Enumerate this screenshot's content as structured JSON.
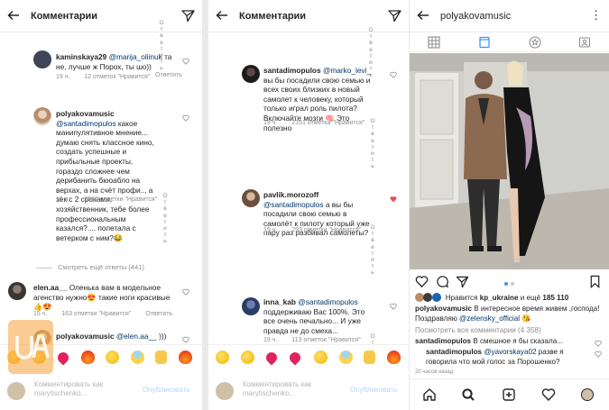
{
  "colors": {
    "mention": "#00376b",
    "meta_gray": "#8e8e8e",
    "heart_red": "#ed4956",
    "publish_disabled": "#b4d5fb",
    "watermark_orange": "#f5a23a"
  },
  "left_panel": {
    "title": "Комментарии",
    "comments": [
      {
        "username": "kaminskaya29",
        "mention": "@marija_oliinuk",
        "text": "та не, лучше ж Порох, ты шо))",
        "time": "19 ч.",
        "likes": "12 отметок \"Нравится\"",
        "reply": "Ответить"
      },
      {
        "username": "polyakovamusic",
        "mention": "@santadimopulos",
        "text": "какое манипулятивное мнение... думаю снять классное кино, создать успешные и прибыльные проекты, гораздо сложнее чем дерибанить бюоабло на верхах, а на счёт профи.., а зек с 2 сроками, хозяйственник, тебе более профессиональным казался?.... полетала с ветерком с ним?😂",
        "time": "19 ч.",
        "likes": "1582 отметки \"Нравится\"",
        "reply": "Ответить"
      },
      {
        "username": "elen.aa__",
        "mention": "",
        "text": "Оленька вам в модельное агенство нужно😍 такие ноги красивые 👍😍",
        "time": "15 ч.",
        "likes": "163 отметки \"Нравится\"",
        "reply": "Ответить"
      },
      {
        "username": "polyakovamusic",
        "mention": "@elen.aa__",
        "text": "))) наконец то хоть кто то заметил",
        "time": "",
        "likes": "",
        "reply": ""
      }
    ],
    "view_more": "Смотреть ещё ответы (441)",
    "input_placeholder": "Комментировать как marytischenko...",
    "publish": "Опубликовать"
  },
  "middle_panel": {
    "title": "Комментарии",
    "comments": [
      {
        "username": "santadimopulos",
        "mention": "@marko_levi_",
        "text": "вы бы посадили свою семью и всех своих близких в новый самолет к человеку, который только играл роль пилота? Включайте мозги 🧠 Это полезно",
        "time": "19 ч.",
        "likes": "2161 отметка \"Нравится\"",
        "reply": "Ответить"
      },
      {
        "username": "pavlik.morozoff",
        "mention": "@santadimopulos",
        "text": "а вы бы посадили свою семью в самолёт к пилоту который уже пару раз разбивал самолеты?",
        "time": "19 ч.",
        "likes": "293 отметки \"Нравится\"",
        "reply": "Ответить"
      },
      {
        "username": "inna_kab",
        "mention": "@santadimopulos",
        "text": "поддерживаю Вас 100%. Это все очень печально... И уже правда не до смеха...",
        "time": "19 ч.",
        "likes": "113 отметок \"Нравится\"",
        "reply": "Ответить"
      }
    ],
    "input_placeholder": "Комментировать как marytischenko...",
    "publish": "Опубликовать"
  },
  "profile_panel": {
    "title": "polyakovamusic",
    "liked_prefix": "Нравится",
    "liked_user": "kp_ukraine",
    "liked_middle": "и ещё",
    "liked_count": "185 110",
    "caption_user": "polyakovamusic",
    "caption_text": "В интересное время живем ,господа! Поздравляю",
    "caption_tag": "@zelensky_official",
    "caption_emoji": "😘",
    "view_comments": "Посмотреть все комментарии (4 358)",
    "comment1_user": "santadimopulos",
    "comment1_text": "В смешное я бы сказала...",
    "reply_user": "santadimopulos",
    "reply_mention": "@yavorskaya02",
    "reply_text": "разве я говорила что мой голос за Порошенко?",
    "time_ago": "20 часов назад"
  },
  "emojis": [
    "😂",
    "😍",
    "❤️",
    "🔥",
    "🤔",
    "😱",
    "🙌",
    "🔥"
  ],
  "icons": {
    "back": "back-arrow-icon",
    "send": "paper-plane-icon",
    "heart": "heart-icon",
    "more": "more-dots-icon",
    "grid": "grid-icon",
    "feed": "feed-icon",
    "igtv": "igtv-icon",
    "tagged": "tagged-icon",
    "comment": "comment-icon",
    "share": "share-icon",
    "save": "bookmark-icon",
    "home": "home-icon",
    "search": "search-icon",
    "add": "add-post-icon",
    "activity": "heart-icon",
    "profile": "profile-avatar-icon"
  }
}
